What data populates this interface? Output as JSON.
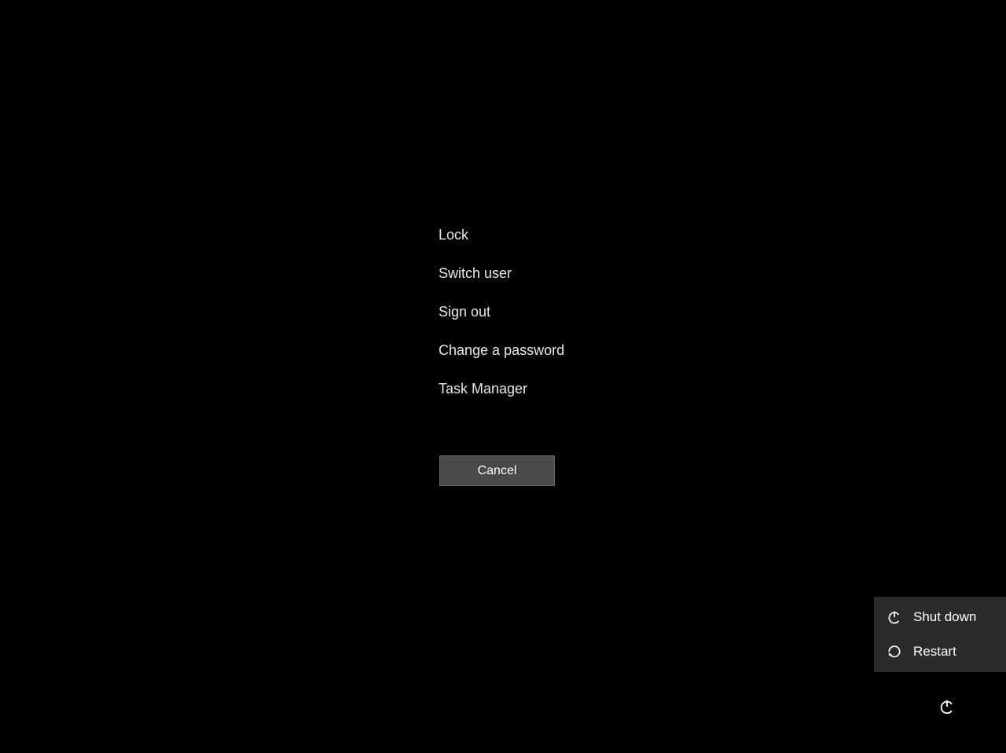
{
  "security_options": {
    "lock": "Lock",
    "switch_user": "Switch user",
    "sign_out": "Sign out",
    "change_password": "Change a password",
    "task_manager": "Task Manager"
  },
  "cancel_label": "Cancel",
  "power_menu": {
    "shut_down": "Shut down",
    "restart": "Restart"
  }
}
